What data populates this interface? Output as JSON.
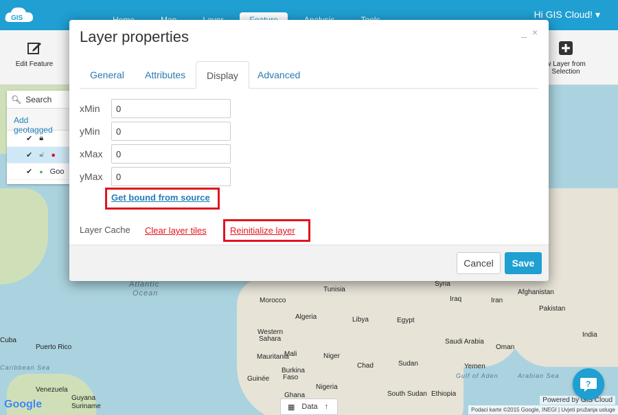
{
  "app": {
    "greeting": "Hi GIS Cloud!",
    "nav_tabs": [
      "Home",
      "Map",
      "Layer",
      "Feature",
      "Analysis",
      "Tools"
    ],
    "active_tab": "Feature"
  },
  "ribbon": {
    "edit_feature_label": "Edit Feature",
    "new_layer_label_1": "w Layer from",
    "new_layer_label_2": "Selection"
  },
  "left_panel": {
    "search_label": "Search",
    "add_geotagged_label": "Add geotagged",
    "row3_label": "Goo"
  },
  "map": {
    "labels": {
      "atlantic": "Atlantic",
      "ocean": "Ocean",
      "morocco": "Morocco",
      "algeria": "Algeria",
      "libya": "Libya",
      "egypt": "Egypt",
      "mali": "Mali",
      "niger": "Niger",
      "chad": "Chad",
      "sudan": "Sudan",
      "nigeria": "Nigeria",
      "ethiopia": "Ethiopia",
      "saudi": "Saudi Arabia",
      "iraq": "Iraq",
      "iran": "Iran",
      "afghanistan": "Afghanistan",
      "pakistan": "Pakistan",
      "india": "India",
      "oman": "Oman",
      "yemen": "Yemen",
      "mauritania": "Mauritania",
      "south_sudan": "South Sudan",
      "western": "Western",
      "sahara": "Sahara",
      "tunisia": "Tunisia",
      "syria": "Syria",
      "gulf_aden": "Gulf of Aden",
      "arabian_sea": "Arabian Sea",
      "puerto_rico": "Puerto Rico",
      "cuba": "Cuba",
      "caribbean": "Caribbean Sea",
      "venezuela": "Venezuela",
      "guyana": "Guyana",
      "suriname": "Suriname",
      "ghana": "Ghana",
      "guinee": "Guinée",
      "burkina": "Burkina",
      "faso": "Faso"
    },
    "google_label": "Google",
    "data_tab_label": "Data",
    "attribution": "Podaci karte ©2015 Google, INEGI | Uvjeti pružanja usluge",
    "powered_by": "Powered by GIS Cloud"
  },
  "modal": {
    "title": "Layer properties",
    "tabs": [
      "General",
      "Attributes",
      "Display",
      "Advanced"
    ],
    "active_tab": "Display",
    "fields": {
      "xmin": {
        "label": "xMin",
        "value": "0"
      },
      "ymin": {
        "label": "yMin",
        "value": "0"
      },
      "xmax": {
        "label": "xMax",
        "value": "0"
      },
      "ymax": {
        "label": "yMax",
        "value": "0"
      }
    },
    "get_bound_label": "Get bound from source",
    "layer_cache_label": "Layer Cache",
    "clear_tiles_label": "Clear layer tiles",
    "reinit_label": "Reinitialize layer",
    "cancel_label": "Cancel",
    "save_label": "Save"
  },
  "colors": {
    "brand": "#1f9fd2",
    "highlight": "#e0141e"
  }
}
